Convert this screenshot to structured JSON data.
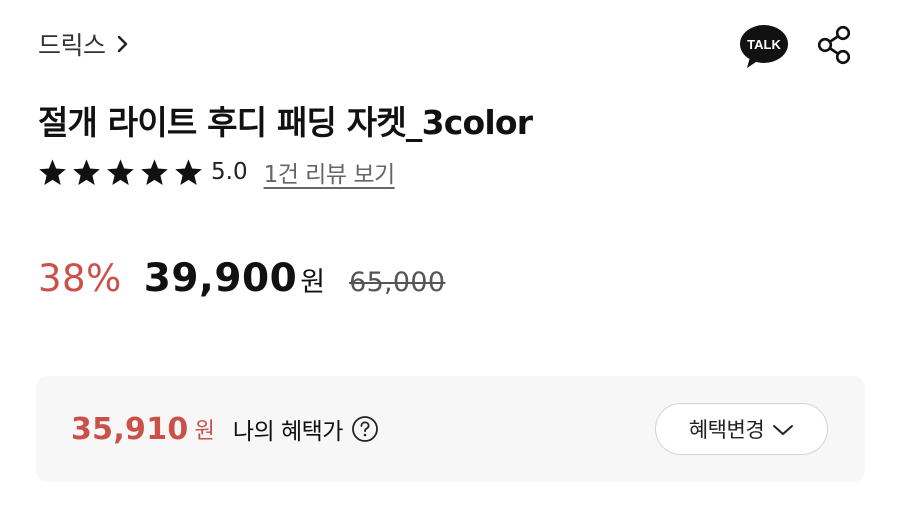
{
  "brand": {
    "name": "드릭스"
  },
  "header_icons": {
    "talk": "TALK",
    "share": "share-icon"
  },
  "product": {
    "title": "절개 라이트 후디 패딩 자켓_3color"
  },
  "rating": {
    "stars": 5,
    "score": "5.0",
    "review_link": "1건 리뷰 보기"
  },
  "price": {
    "discount_rate": "38%",
    "sale_price": "39,900",
    "unit": "원",
    "original_price": "65,000"
  },
  "benefit": {
    "price": "35,910",
    "unit": "원",
    "label": "나의 혜택가",
    "button_label": "혜택변경"
  },
  "colors": {
    "accent_red": "#c9514a",
    "text_dark": "#111111",
    "box_bg": "#f7f7f7"
  }
}
